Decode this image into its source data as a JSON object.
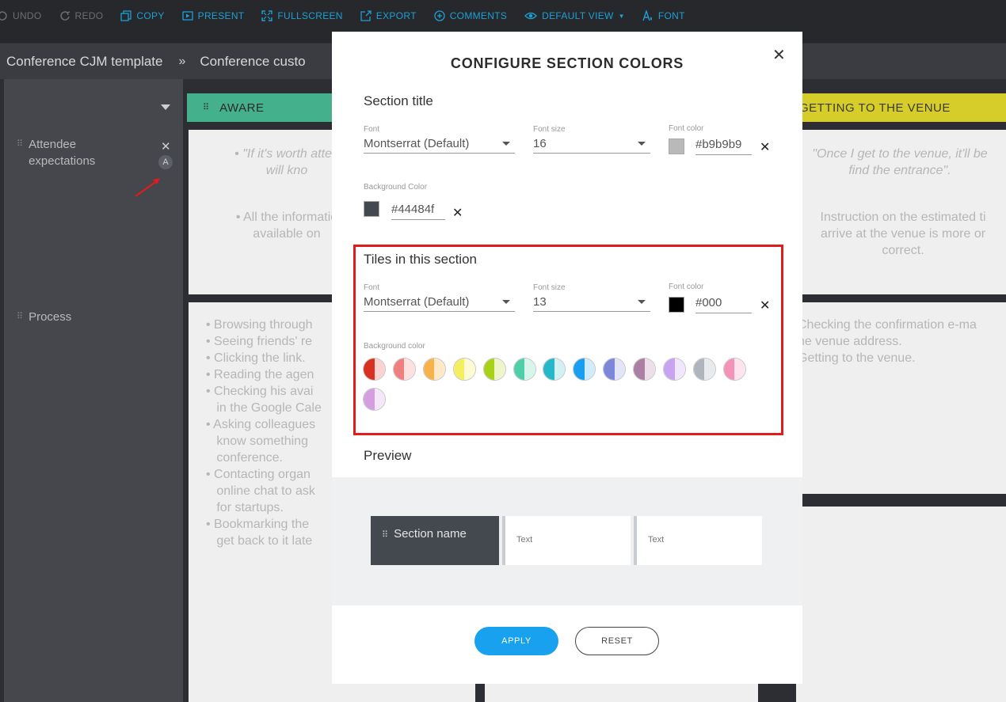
{
  "toolbar": {
    "items": [
      {
        "label": "UNDO",
        "icon": "undo-icon",
        "enabled": false
      },
      {
        "label": "REDO",
        "icon": "redo-icon",
        "enabled": false
      },
      {
        "label": "COPY",
        "icon": "copy-icon",
        "enabled": true
      },
      {
        "label": "PRESENT",
        "icon": "present-icon",
        "enabled": true
      },
      {
        "label": "FULLSCREEN",
        "icon": "fullscreen-icon",
        "enabled": true
      },
      {
        "label": "EXPORT",
        "icon": "export-icon",
        "enabled": true
      },
      {
        "label": "COMMENTS",
        "icon": "comments-icon",
        "enabled": true
      },
      {
        "label": "DEFAULT VIEW",
        "icon": "eye-icon",
        "enabled": true
      },
      {
        "label": "FONT",
        "icon": "font-icon",
        "enabled": true
      }
    ]
  },
  "breadcrumb": {
    "first": "Conference CJM template",
    "separator": "»",
    "second": "Conference custo"
  },
  "board": {
    "rows": [
      {
        "label": "Attendee expectations"
      },
      {
        "label": "Process"
      }
    ],
    "columns": [
      {
        "header": "AWARE",
        "color": "#45b08c"
      },
      {
        "header": "GETTING TO THE VENUE",
        "color": "#d6cc2a"
      }
    ],
    "tiles": {
      "aware_expectations": [
        "\"If it's worth atten",
        "will kno",
        "All the informatio",
        "available on"
      ],
      "venue_expectations": [
        "\"Once I get to the venue, it'll be",
        "find the entrance\".",
        "Instruction on the estimated ti",
        "arrive at the venue is more or",
        "correct."
      ],
      "aware_process": [
        "Browsing through",
        "Seeing friends' re",
        "Clicking the link.",
        "Reading the agen",
        "Checking his avai",
        "in the Google Cale",
        "Asking colleagues",
        "know something",
        "conference.",
        "Contacting organ",
        "online chat to ask",
        "for startups.",
        "Bookmarking the",
        "get back to it late"
      ],
      "venue_process": [
        "Checking the confirmation  e-ma",
        "he venue address.",
        "Getting to the venue."
      ]
    }
  },
  "modal": {
    "title": "CONFIGURE SECTION COLORS",
    "section_title": {
      "heading": "Section title",
      "font_label": "Font",
      "font_value": "Montserrat (Default)",
      "size_label": "Font size",
      "size_value": "16",
      "color_label": "Font color",
      "color_value": "#b9b9b9",
      "swatch": "#b9b9b9",
      "bg_label": "Background Color",
      "bg_value": "#44484f",
      "bg_swatch": "#44484f"
    },
    "tiles_section": {
      "heading": "Tiles in this section",
      "font_label": "Font",
      "font_value": "Montserrat (Default)",
      "size_label": "Font size",
      "size_value": "13",
      "color_label": "Font color",
      "color_value": "#000",
      "swatch": "#000000",
      "bg_label": "Background color",
      "palette": [
        {
          "name": "red",
          "dark": "#d9301f",
          "light": "#fad2d0"
        },
        {
          "name": "salmon",
          "dark": "#f07f80",
          "light": "#fde0e0"
        },
        {
          "name": "orange",
          "dark": "#f7b24b",
          "light": "#fde9c8"
        },
        {
          "name": "yellow",
          "dark": "#f5ef60",
          "light": "#fdfbd2"
        },
        {
          "name": "lime",
          "dark": "#a8d11a",
          "light": "#eef6c9"
        },
        {
          "name": "mint",
          "dark": "#4fcfa7",
          "light": "#d8f5ec"
        },
        {
          "name": "teal",
          "dark": "#26b8c9",
          "light": "#d2f1f5"
        },
        {
          "name": "blue",
          "dark": "#1a9ef0",
          "light": "#d0ebfc"
        },
        {
          "name": "periwinkle",
          "dark": "#7e86d9",
          "light": "#e2e4f7"
        },
        {
          "name": "mauve",
          "dark": "#ad7fa3",
          "light": "#ecdfe9"
        },
        {
          "name": "lavender",
          "dark": "#c7a3f2",
          "light": "#f1e7fc"
        },
        {
          "name": "gray",
          "dark": "#aeb5bd",
          "light": "#e8ebee"
        },
        {
          "name": "pink",
          "dark": "#f592b8",
          "light": "#fde3ee"
        },
        {
          "name": "orchid",
          "dark": "#d59ee0",
          "light": "#f5e6f8"
        }
      ]
    },
    "preview": {
      "heading": "Preview",
      "section_name": "Section name",
      "tile_text_1": "Text",
      "tile_text_2": "Text"
    },
    "buttons": {
      "apply": "APPLY",
      "reset": "RESET"
    }
  }
}
